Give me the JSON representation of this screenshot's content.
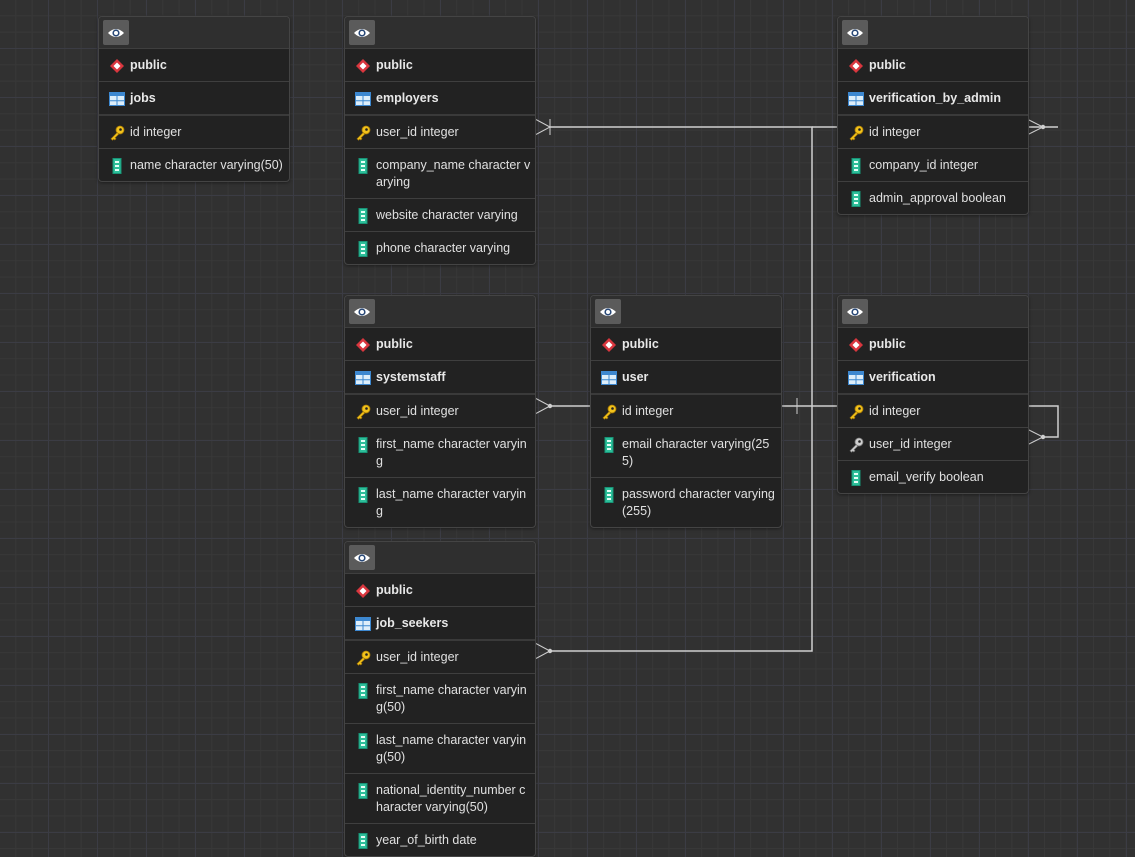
{
  "canvas": {
    "background": "#313131",
    "grid_color": "#3b3c44"
  },
  "icon_names": {
    "view": "eye-icon",
    "schema": "schema-diamond-icon",
    "table": "table-grid-icon",
    "primary_key": "primary-key-icon",
    "foreign_key": "foreign-key-icon",
    "column": "column-icon"
  },
  "tables": [
    {
      "id": "jobs",
      "schema": "public",
      "name": "jobs",
      "columns": [
        {
          "text": "id integer",
          "kind": "pk"
        },
        {
          "text": "name character varying(50)",
          "kind": "col"
        }
      ]
    },
    {
      "id": "employers",
      "schema": "public",
      "name": "employers",
      "columns": [
        {
          "text": "user_id integer",
          "kind": "pk"
        },
        {
          "text": "company_name character varying",
          "kind": "col"
        },
        {
          "text": "website character varying",
          "kind": "col"
        },
        {
          "text": "phone character varying",
          "kind": "col"
        }
      ]
    },
    {
      "id": "verification_by_admin",
      "schema": "public",
      "name": "verification_by_admin",
      "columns": [
        {
          "text": "id integer",
          "kind": "pk"
        },
        {
          "text": "company_id integer",
          "kind": "col"
        },
        {
          "text": "admin_approval boolean",
          "kind": "col"
        }
      ]
    },
    {
      "id": "systemstaff",
      "schema": "public",
      "name": "systemstaff",
      "columns": [
        {
          "text": "user_id integer",
          "kind": "pk"
        },
        {
          "text": "first_name character varying",
          "kind": "col"
        },
        {
          "text": "last_name character varying",
          "kind": "col"
        }
      ]
    },
    {
      "id": "user",
      "schema": "public",
      "name": "user",
      "columns": [
        {
          "text": "id integer",
          "kind": "pk"
        },
        {
          "text": "email character varying(255)",
          "kind": "col"
        },
        {
          "text": "password character varying(255)",
          "kind": "col"
        }
      ]
    },
    {
      "id": "verification",
      "schema": "public",
      "name": "verification",
      "columns": [
        {
          "text": "id integer",
          "kind": "pk"
        },
        {
          "text": "user_id integer",
          "kind": "fk"
        },
        {
          "text": "email_verify boolean",
          "kind": "col"
        }
      ]
    },
    {
      "id": "job_seekers",
      "schema": "public",
      "name": "job_seekers",
      "columns": [
        {
          "text": "user_id integer",
          "kind": "pk"
        },
        {
          "text": "first_name character varying(50)",
          "kind": "col"
        },
        {
          "text": "last_name character varying(50)",
          "kind": "col"
        },
        {
          "text": "national_identity_number character varying(50)",
          "kind": "col"
        },
        {
          "text": "year_of_birth date",
          "kind": "col"
        }
      ]
    }
  ],
  "relationships": [
    {
      "from": "user.id",
      "to": "employers.user_id",
      "cardinality": "one-to-many"
    },
    {
      "from": "user.id",
      "to": "systemstaff.user_id",
      "cardinality": "one-to-many"
    },
    {
      "from": "user.id",
      "to": "job_seekers.user_id",
      "cardinality": "one-to-many"
    },
    {
      "from": "user.id",
      "to": "verification_by_admin.id",
      "cardinality": "one-to-many"
    },
    {
      "from": "verification.id",
      "to": "verification.user_id",
      "cardinality": "one-to-many"
    }
  ]
}
